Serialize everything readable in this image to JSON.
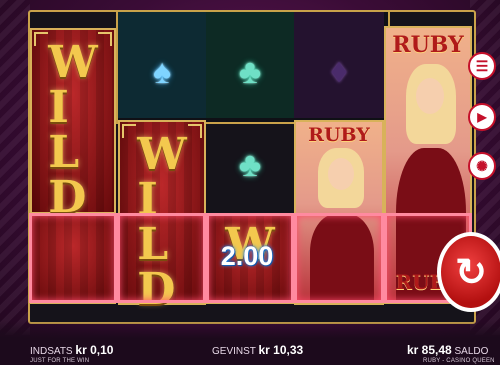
{
  "reels": {
    "row1": [
      {
        "symbol": "WILD"
      },
      {
        "symbol": "spade-icon"
      },
      {
        "symbol": "club-icon"
      },
      {
        "symbol": "diamond-icon"
      },
      {
        "symbol": "RUBY"
      }
    ],
    "wild_text": "WILD",
    "ruby_text": "RUBY",
    "win_overlay": "2.00"
  },
  "footer": {
    "bet_label": "INDSATS",
    "bet_value": "kr 0,10",
    "subtext": "JUST FOR THE WIN",
    "win_label": "GEVINST",
    "win_value": "kr 10,33",
    "balance_value": "kr 85,48",
    "balance_label": "SALDO",
    "game_name": "RUBY - CASINO QUEEN"
  },
  "side_controls": [
    {
      "name": "menu-button",
      "icon": "menu-icon"
    },
    {
      "name": "autoplay-button",
      "icon": "play-icon"
    },
    {
      "name": "bet-settings-button",
      "icon": "chip-icon"
    }
  ],
  "colors": {
    "frame_gold": "#c9a24a",
    "spin_red": "#c4102a",
    "highlight_pink": "#ff8aa0"
  }
}
